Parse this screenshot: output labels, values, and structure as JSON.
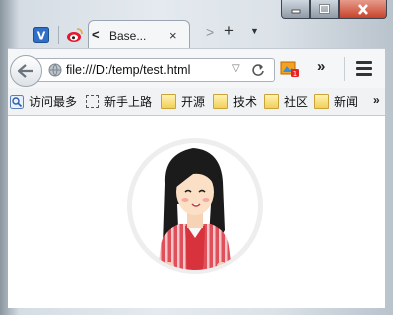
{
  "window": {
    "minimize_icon": "minimize-icon",
    "maximize_icon": "maximize-icon",
    "close_icon": "close-icon"
  },
  "tabs": {
    "pinned": [
      "v-icon",
      "weibo-icon"
    ],
    "active_title": "Base...",
    "scroll_left": "<",
    "close": "×",
    "scroll_right": ">",
    "new_tab": "+",
    "tab_list": "▼"
  },
  "nav": {
    "url": "file:///D:/temp/test.html",
    "dropmarker": "▽",
    "reload": "C",
    "more": "»"
  },
  "bookmarks": {
    "items": [
      {
        "label": "访问最多",
        "icon": "search-icon"
      },
      {
        "label": "新手上路",
        "icon": "dashed-box-icon"
      },
      {
        "label": "开源",
        "icon": "folder-icon"
      },
      {
        "label": "技术",
        "icon": "folder-icon"
      },
      {
        "label": "社区",
        "icon": "folder-icon"
      },
      {
        "label": "新闻",
        "icon": "folder-icon"
      }
    ],
    "more": "»"
  },
  "content": {
    "avatar": "girl-avatar-image"
  },
  "colors": {
    "accent_red": "#d8323c",
    "avatar_ring": "#eeeeee"
  }
}
